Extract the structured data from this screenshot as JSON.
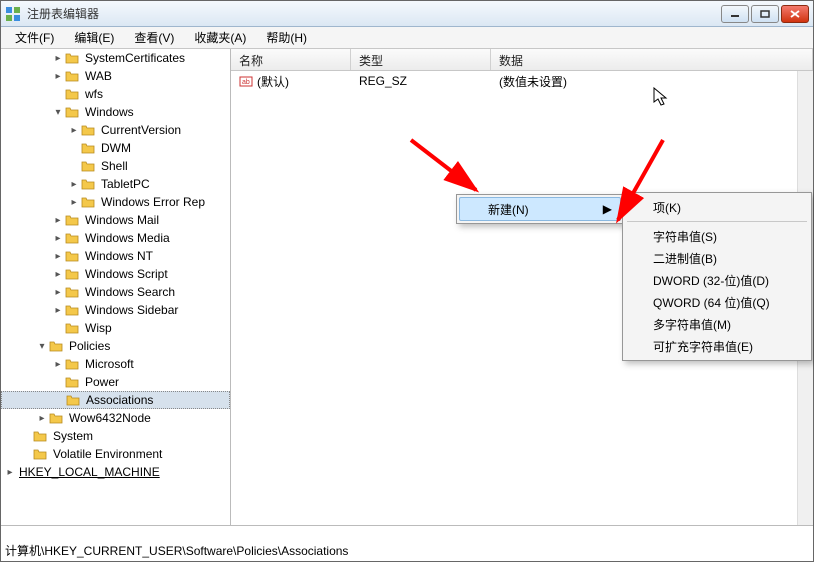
{
  "window": {
    "title": "注册表编辑器"
  },
  "menubar": {
    "file": "文件(F)",
    "edit": "编辑(E)",
    "view": "查看(V)",
    "favorites": "收藏夹(A)",
    "help": "帮助(H)"
  },
  "list": {
    "headers": {
      "name": "名称",
      "type": "类型",
      "data": "数据"
    },
    "rows": [
      {
        "name": "(默认)",
        "type": "REG_SZ",
        "data": "(数值未设置)"
      }
    ]
  },
  "tree": {
    "items": [
      {
        "d": 2,
        "e": "right",
        "t": "SystemCertificates"
      },
      {
        "d": 2,
        "e": "right",
        "t": "WAB"
      },
      {
        "d": 2,
        "e": "none",
        "t": "wfs"
      },
      {
        "d": 2,
        "e": "down",
        "t": "Windows"
      },
      {
        "d": 3,
        "e": "right",
        "t": "CurrentVersion"
      },
      {
        "d": 3,
        "e": "none",
        "t": "DWM"
      },
      {
        "d": 3,
        "e": "none",
        "t": "Shell"
      },
      {
        "d": 3,
        "e": "right",
        "t": "TabletPC"
      },
      {
        "d": 3,
        "e": "right",
        "t": "Windows Error Rep"
      },
      {
        "d": 2,
        "e": "right",
        "t": "Windows Mail"
      },
      {
        "d": 2,
        "e": "right",
        "t": "Windows Media"
      },
      {
        "d": 2,
        "e": "right",
        "t": "Windows NT"
      },
      {
        "d": 2,
        "e": "right",
        "t": "Windows Script"
      },
      {
        "d": 2,
        "e": "right",
        "t": "Windows Search"
      },
      {
        "d": 2,
        "e": "right",
        "t": "Windows Sidebar"
      },
      {
        "d": 2,
        "e": "none",
        "t": "Wisp"
      },
      {
        "d": 1,
        "e": "down",
        "t": "Policies"
      },
      {
        "d": 2,
        "e": "right",
        "t": "Microsoft"
      },
      {
        "d": 2,
        "e": "none",
        "t": "Power"
      },
      {
        "d": 2,
        "e": "none",
        "t": "Associations",
        "sel": true
      },
      {
        "d": 1,
        "e": "right",
        "t": "Wow6432Node"
      },
      {
        "d": 0,
        "e": "none",
        "t": "System"
      },
      {
        "d": 0,
        "e": "none",
        "t": "Volatile Environment"
      },
      {
        "d": -1,
        "e": "right",
        "t": "HKEY_LOCAL_MACHINE",
        "root": true
      }
    ]
  },
  "context": {
    "new_label": "新建(N)",
    "submenu": [
      {
        "label": "项(K)"
      },
      {
        "sep": true
      },
      {
        "label": "字符串值(S)"
      },
      {
        "label": "二进制值(B)"
      },
      {
        "label": "DWORD (32-位)值(D)"
      },
      {
        "label": "QWORD (64 位)值(Q)"
      },
      {
        "label": "多字符串值(M)"
      },
      {
        "label": "可扩充字符串值(E)"
      }
    ]
  },
  "statusbar": {
    "path": "计算机\\HKEY_CURRENT_USER\\Software\\Policies\\Associations"
  }
}
